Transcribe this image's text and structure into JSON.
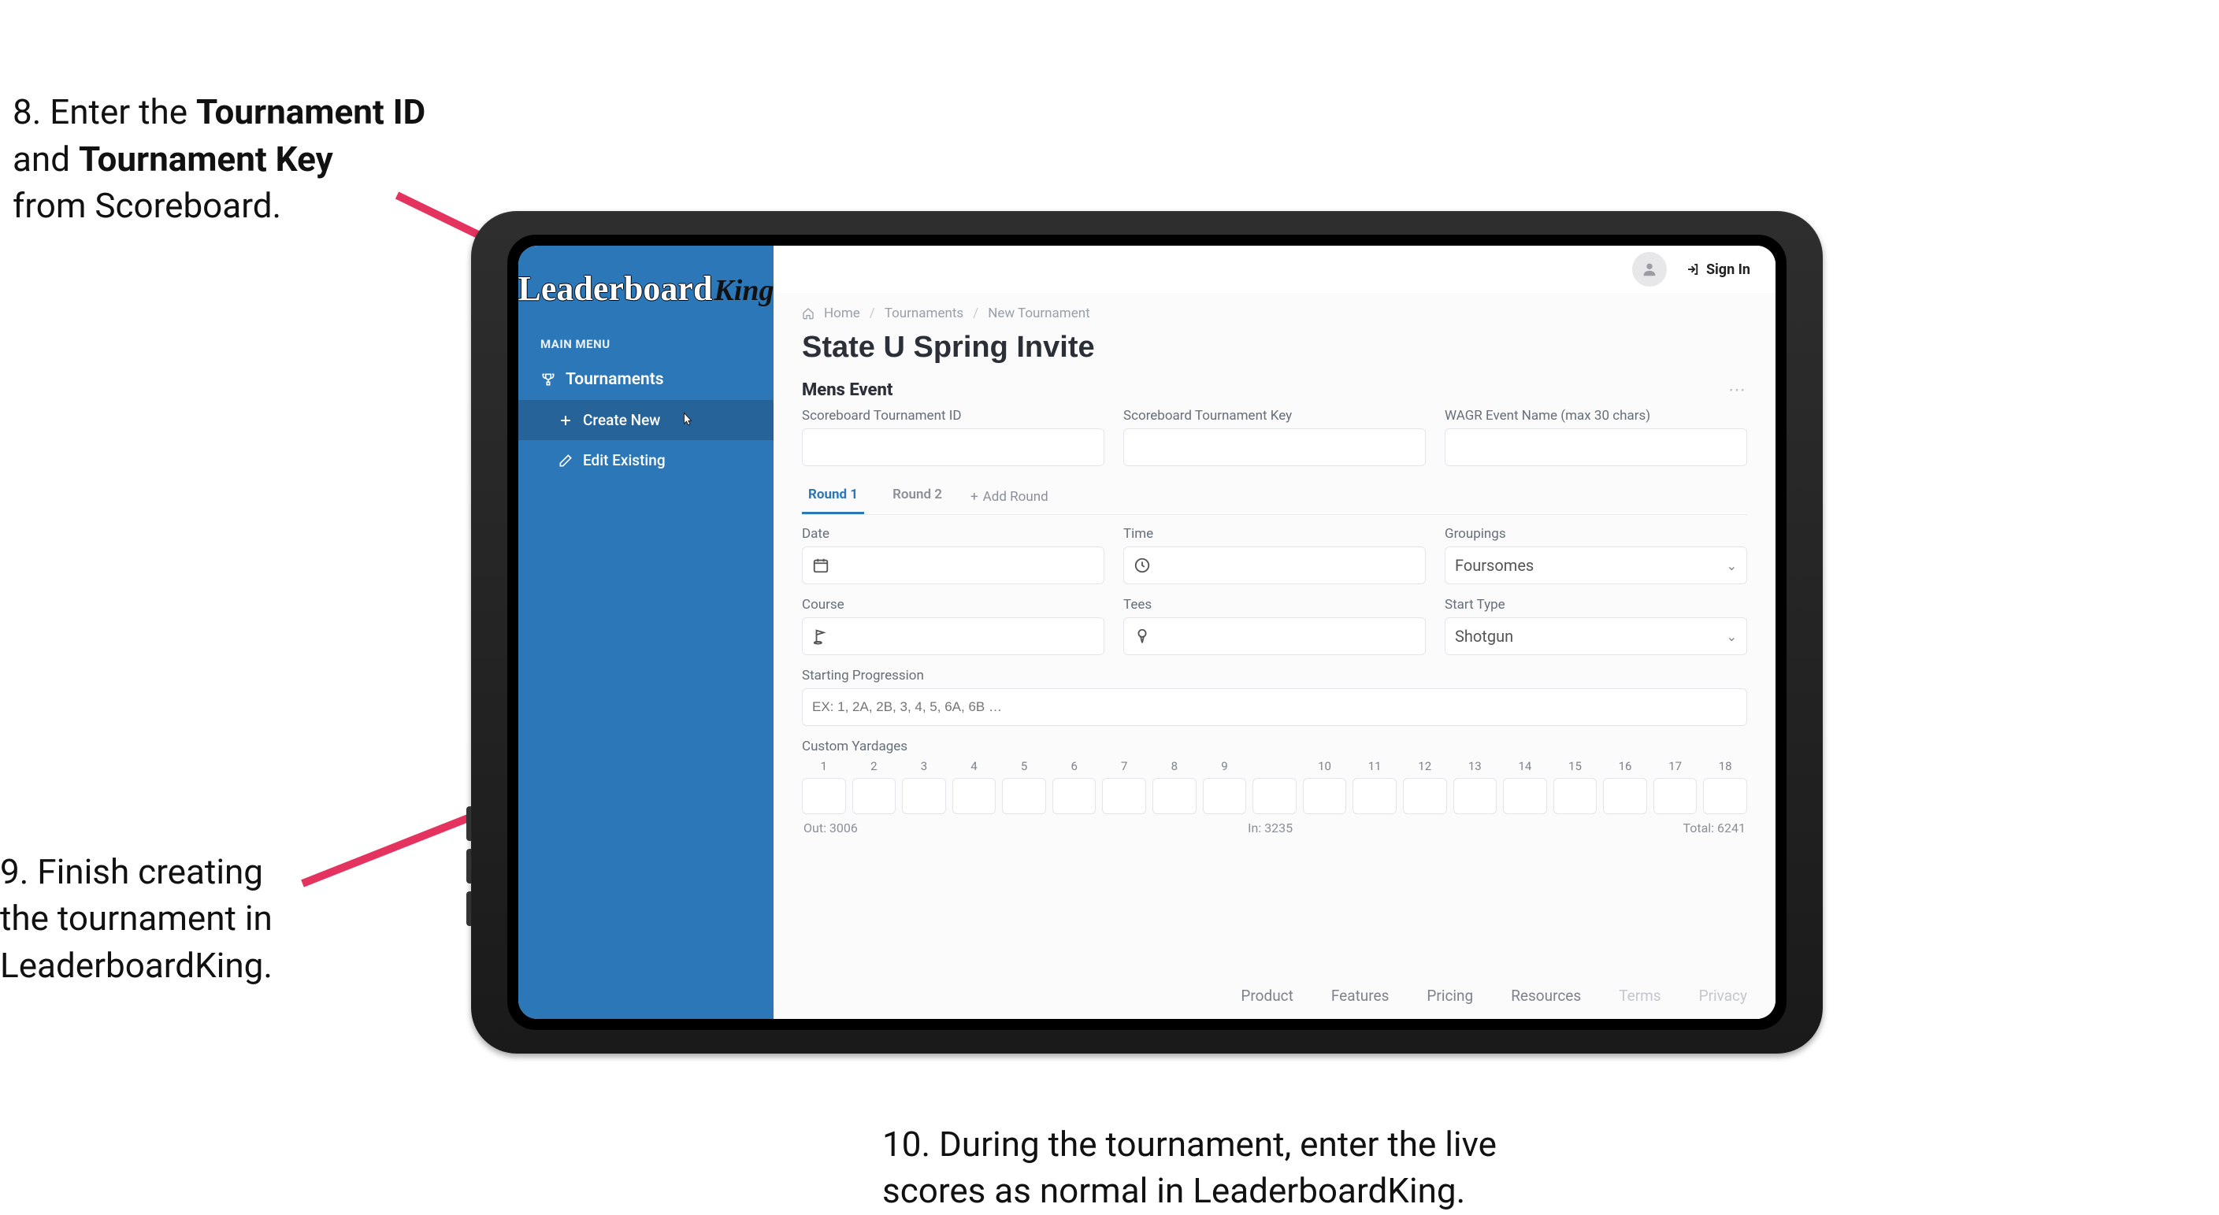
{
  "callouts": {
    "step8_num": "8. ",
    "step8_pre": "Enter the ",
    "step8_b1": "Tournament ID",
    "step8_mid": "\nand ",
    "step8_b2": "Tournament Key",
    "step8_post": "\nfrom Scoreboard.",
    "step9": "9. Finish creating\nthe tournament in\nLeaderboardKing.",
    "step10": "10. During the tournament, enter the live\nscores as normal in LeaderboardKing."
  },
  "colors": {
    "arrow": "#e4335f",
    "sidebar": "#2b77b8",
    "tab_active": "#2b77b8"
  },
  "logo": {
    "leader": "Leaderboard",
    "king": "King"
  },
  "sidebar": {
    "menu_label": "MAIN MENU",
    "tournaments": "Tournaments",
    "create_new": "Create New",
    "edit_existing": "Edit Existing"
  },
  "topbar": {
    "signin": "Sign In"
  },
  "breadcrumb": {
    "home": "Home",
    "tournaments": "Tournaments",
    "current": "New Tournament"
  },
  "page": {
    "title": "State U Spring Invite",
    "section": "Mens Event"
  },
  "fields": {
    "sb_id": "Scoreboard Tournament ID",
    "sb_key": "Scoreboard Tournament Key",
    "wagr": "WAGR Event Name (max 30 chars)",
    "date": "Date",
    "time": "Time",
    "groupings": "Groupings",
    "groupings_value": "Foursomes",
    "course": "Course",
    "tees": "Tees",
    "start_type": "Start Type",
    "start_type_value": "Shotgun",
    "starting_prog": "Starting Progression",
    "starting_prog_ph": "EX: 1, 2A, 2B, 3, 4, 5, 6A, 6B …",
    "custom_yard": "Custom Yardages"
  },
  "tabs": {
    "r1": "Round 1",
    "r2": "Round 2",
    "add": "Add Round"
  },
  "yardage": {
    "holes": [
      "1",
      "2",
      "3",
      "4",
      "5",
      "6",
      "7",
      "8",
      "9",
      "10",
      "11",
      "12",
      "13",
      "14",
      "15",
      "16",
      "17",
      "18"
    ],
    "out_label": "Out:",
    "out_value": "3006",
    "in_label": "In:",
    "in_value": "3235",
    "total_label": "Total:",
    "total_value": "6241"
  },
  "footer": [
    "Product",
    "Features",
    "Pricing",
    "Resources",
    "Terms",
    "Privacy"
  ]
}
